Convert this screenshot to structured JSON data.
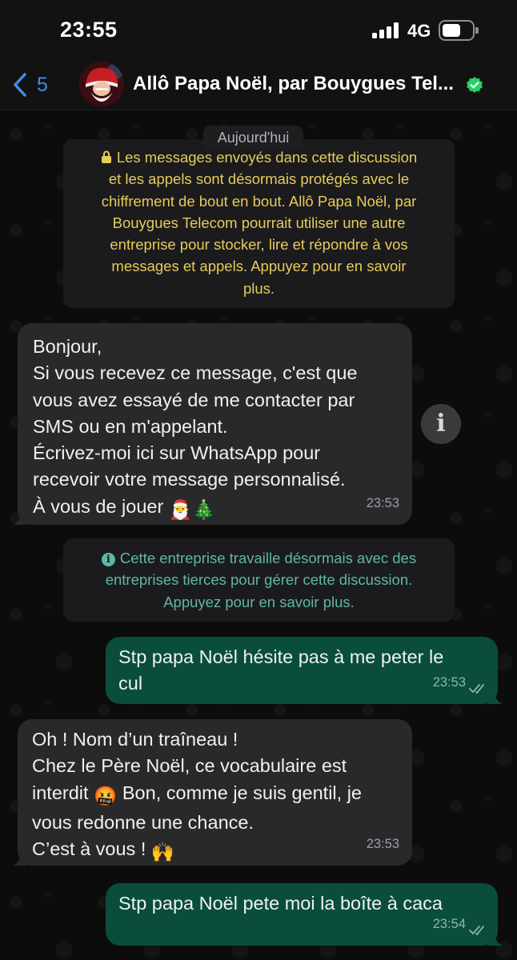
{
  "status_bar": {
    "time": "23:55",
    "network": "4G"
  },
  "header": {
    "back_count": "5",
    "title": "Allô Papa Noël, par Bouygues Tel..."
  },
  "chat": {
    "date_chip": "Aujourd'hui",
    "encryption_notice": [
      "Les messages envoyés dans cette discussion",
      "et les appels sont désormais protégés avec le",
      "chiffrement de bout en bout. Allô Papa Noël, par",
      "Bouygues Telecom pourrait utiliser une autre",
      "entreprise pour stocker, lire et répondre à vos",
      "messages et appels. Appuyez pour en savoir",
      "plus."
    ],
    "third_party_notice": [
      "Cette entreprise travaille désormais avec des",
      "entreprises tierces pour gérer cette discussion.",
      "Appuyez pour en savoir plus."
    ],
    "messages": [
      {
        "direction": "in",
        "lines": [
          "Bonjour,",
          "Si vous recevez ce message, c'est que",
          "vous avez essayé de me contacter par",
          "SMS ou en m'appelant.",
          "Écrivez-moi ici sur WhatsApp pour",
          "recevoir votre message personnalisé.",
          "À vous de jouer"
        ],
        "emoji": "🎅🎄",
        "time": "23:53"
      },
      {
        "direction": "out",
        "lines": [
          "Stp papa Noël hésite pas à me peter le",
          "cul"
        ],
        "time": "23:53",
        "status": "read"
      },
      {
        "direction": "in",
        "lines": [
          "Oh ! Nom d’un traîneau !",
          "Chez le Père Noël, ce vocabulaire est",
          "interdit",
          "Bon, comme je suis gentil, je",
          "vous redonne une chance.",
          "C’est à vous !"
        ],
        "emoji_swear": "🤬",
        "emoji_hands": "🙌",
        "time": "23:53"
      },
      {
        "direction": "out",
        "lines": [
          "Stp papa Noël pete moi la boîte à caca"
        ],
        "time": "23:54",
        "status": "read"
      }
    ]
  },
  "colors": {
    "incoming_bubble": "#29292b",
    "outgoing_bubble": "#0a4d3d",
    "accent_blue": "#3d8fe6",
    "notice_yellow": "#e6cc5a",
    "notice_teal": "#5fb7a8",
    "verified_green": "#25d366"
  },
  "icons": [
    "back-chevron-icon",
    "verified-badge-icon",
    "lock-icon",
    "info-icon",
    "read-ticks-icon"
  ]
}
